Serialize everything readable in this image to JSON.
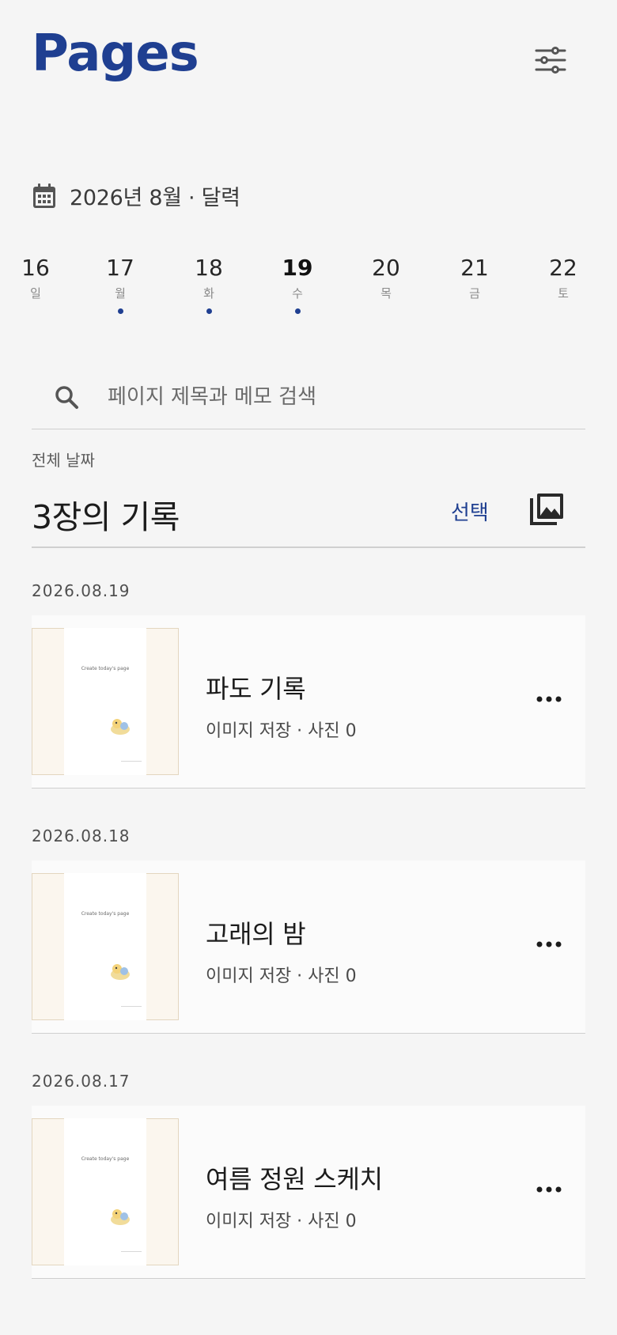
{
  "header": {
    "title": "Pages",
    "filter_icon": "sliders-icon"
  },
  "calendar": {
    "month_label": "2026년 8월 · 달력",
    "icon": "calendar-icon",
    "days": [
      {
        "num": "16",
        "weekday": "일",
        "has_entry": false,
        "selected": false
      },
      {
        "num": "17",
        "weekday": "월",
        "has_entry": true,
        "selected": false
      },
      {
        "num": "18",
        "weekday": "화",
        "has_entry": true,
        "selected": false
      },
      {
        "num": "19",
        "weekday": "수",
        "has_entry": true,
        "selected": true
      },
      {
        "num": "20",
        "weekday": "목",
        "has_entry": false,
        "selected": false
      },
      {
        "num": "21",
        "weekday": "금",
        "has_entry": false,
        "selected": false
      },
      {
        "num": "22",
        "weekday": "토",
        "has_entry": false,
        "selected": false
      }
    ]
  },
  "search": {
    "icon": "search-icon",
    "placeholder": "페이지 제목과 메모 검색",
    "value": ""
  },
  "list": {
    "scope_label": "전체 날짜",
    "count_title": "3장의 기록",
    "select_label": "선택",
    "gallery_icon": "photo-library-icon"
  },
  "entries": [
    {
      "date": "2026.08.19",
      "title": "파도 기록",
      "meta": "이미지 저장 · 사진 0",
      "thumb_caption": "Create today's page"
    },
    {
      "date": "2026.08.18",
      "title": "고래의 밤",
      "meta": "이미지 저장 · 사진 0",
      "thumb_caption": "Create today's page"
    },
    {
      "date": "2026.08.17",
      "title": "여름 정원 스케치",
      "meta": "이미지 저장 · 사진 0",
      "thumb_caption": "Create today's page"
    }
  ],
  "colors": {
    "accent": "#1f3f91",
    "background": "#f5f5f5",
    "thumb_border": "#e3d6bf"
  }
}
